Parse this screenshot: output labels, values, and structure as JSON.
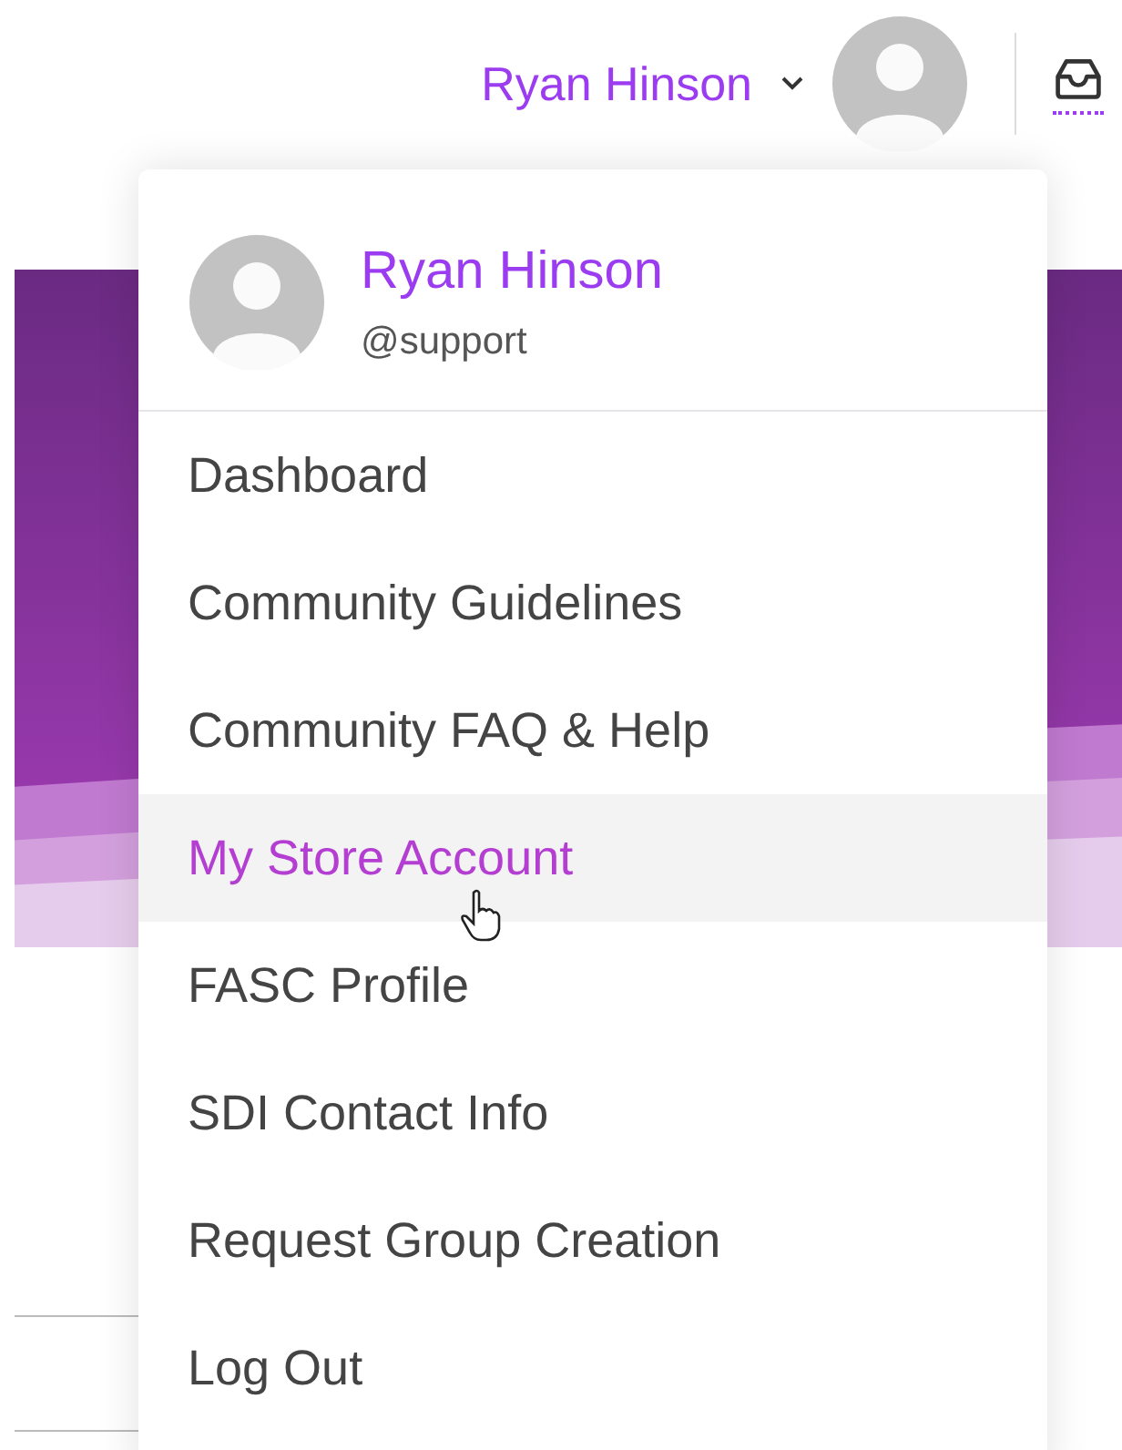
{
  "header": {
    "user_name": "Ryan Hinson",
    "menu_expanded": true
  },
  "dropdown": {
    "user_name": "Ryan Hinson",
    "handle": "@support",
    "items": [
      {
        "label": "Dashboard",
        "selected": false
      },
      {
        "label": "Community Guidelines",
        "selected": false
      },
      {
        "label": "Community FAQ & Help",
        "selected": false
      },
      {
        "label": "My Store Account",
        "selected": true
      },
      {
        "label": "FASC Profile",
        "selected": false
      },
      {
        "label": "SDI Contact Info",
        "selected": false
      },
      {
        "label": "Request Group Creation",
        "selected": false
      },
      {
        "label": "Log Out",
        "selected": false
      }
    ]
  }
}
